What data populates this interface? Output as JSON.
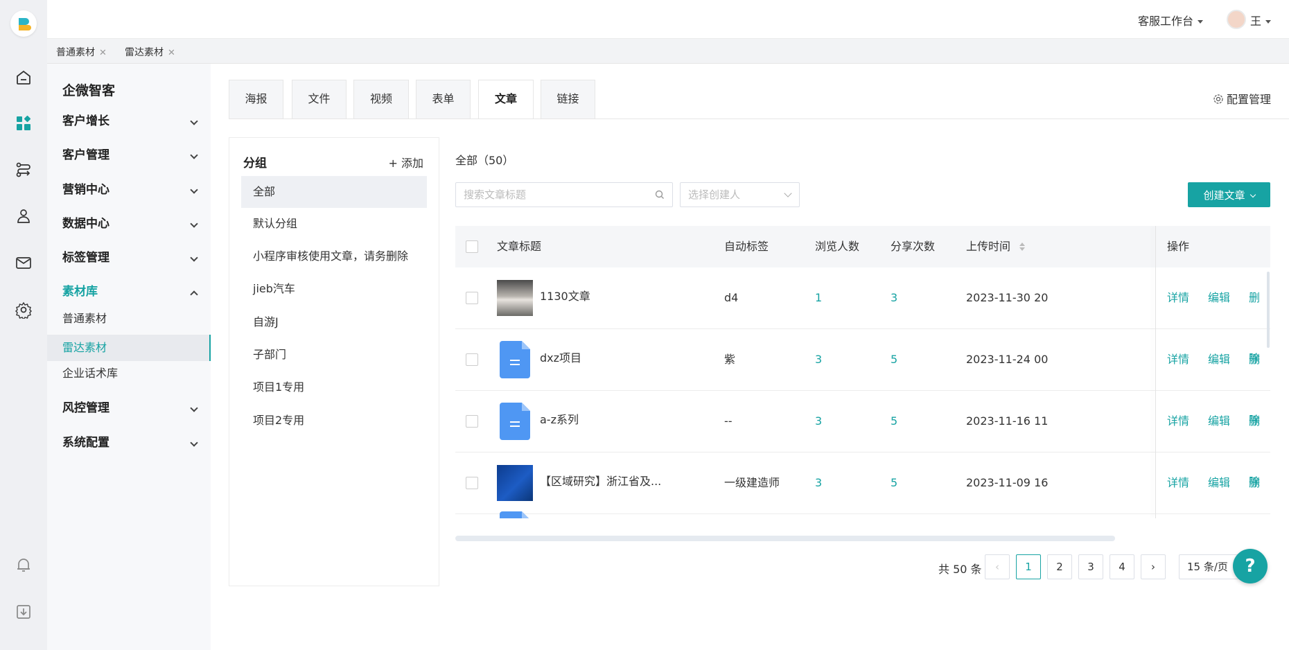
{
  "header": {
    "workbench_label": "客服工作台",
    "user_name": "王"
  },
  "page_tabs": [
    {
      "label": "普通素材"
    },
    {
      "label": "雷达素材"
    }
  ],
  "menu": {
    "title": "企微智客",
    "items": [
      {
        "label": "客户增长"
      },
      {
        "label": "客户管理"
      },
      {
        "label": "营销中心"
      },
      {
        "label": "数据中心"
      },
      {
        "label": "标签管理"
      },
      {
        "label": "素材库"
      },
      {
        "label": "风控管理"
      },
      {
        "label": "系统配置"
      }
    ],
    "sub_items": [
      {
        "label": "普通素材"
      },
      {
        "label": "雷达素材"
      },
      {
        "label": "企业话术库"
      }
    ]
  },
  "type_tabs": [
    {
      "label": "海报"
    },
    {
      "label": "文件"
    },
    {
      "label": "视频"
    },
    {
      "label": "表单"
    },
    {
      "label": "文章"
    },
    {
      "label": "链接"
    }
  ],
  "config_label": "配置管理",
  "groups": {
    "title": "分组",
    "add_label": "+ 添加",
    "items": [
      {
        "label": "全部"
      },
      {
        "label": "默认分组"
      },
      {
        "label": "小程序审核使用文章，请务删除"
      },
      {
        "label": "jieb汽车"
      },
      {
        "label": "自游J"
      },
      {
        "label": "子部门"
      },
      {
        "label": "项目1专用"
      },
      {
        "label": "项目2专用"
      }
    ]
  },
  "content": {
    "count_title": "全部（50）",
    "search_placeholder": "搜索文章标题",
    "creator_placeholder": "选择创建人",
    "create_button": "创建文章"
  },
  "table": {
    "columns": {
      "title": "文章标题",
      "tag": "自动标签",
      "views": "浏览人数",
      "shares": "分享次数",
      "upload_time": "上传时间",
      "actions": "操作"
    },
    "rows": [
      {
        "title": "1130文章",
        "tag": "d4",
        "views": "1",
        "shares": "3",
        "time": "2023-11-30 20",
        "thumb": "photo"
      },
      {
        "title": "dxz项目",
        "tag": "紫",
        "views": "3",
        "shares": "5",
        "time": "2023-11-24 00",
        "thumb": "file"
      },
      {
        "title": "a-z系列",
        "tag": "--",
        "views": "3",
        "shares": "5",
        "time": "2023-11-16 11",
        "thumb": "file"
      },
      {
        "title": "【区域研究】浙江省及...",
        "tag": "一级建造师",
        "views": "3",
        "shares": "5",
        "time": "2023-11-09 16",
        "thumb": "cover"
      }
    ],
    "action_labels": {
      "detail": "详情",
      "edit": "编辑",
      "delete": "删除"
    }
  },
  "pagination": {
    "total_text": "共 50 条",
    "pages": [
      "1",
      "2",
      "3",
      "4"
    ],
    "current_page": "1",
    "page_size": "15 条/页"
  },
  "colors": {
    "accent": "#17a3a3",
    "file_icon": "#4f97f3"
  }
}
